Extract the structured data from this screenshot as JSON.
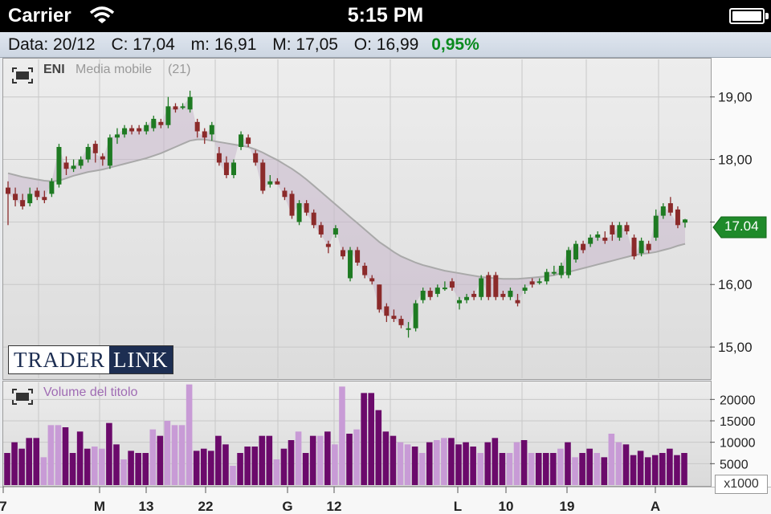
{
  "status": {
    "carrier": "Carrier",
    "time": "5:15 PM"
  },
  "quote": {
    "date": "Data: 20/12",
    "close": "C: 17,04",
    "min": "m: 16,91",
    "max": "M: 17,05",
    "open": "O: 16,99",
    "change": "0,95%"
  },
  "main_chart": {
    "symbol": "ENI",
    "indicator": "Media mobile",
    "indicator_period": "(21)",
    "current_price": "17.04"
  },
  "volume_chart": {
    "label": "Volume del titolo",
    "multiplier": "x1000"
  },
  "logo": {
    "part1": "TRADER",
    "part2": "LINK"
  },
  "colors": {
    "up": "#1e7a22",
    "down": "#8b2a2a",
    "ma_fill": "#c9b8cc",
    "vol_dark": "#6b0a6b",
    "vol_light": "#c89bd6",
    "accent_green": "#0a8a1e"
  },
  "chart_data": [
    {
      "type": "candlestick",
      "title": "ENI",
      "y_ticks": [
        "19,00",
        "18,00",
        "17,00",
        "16,00",
        "15,00"
      ],
      "ylim": [
        14.5,
        19.6
      ],
      "x_ticks": [
        "7",
        "M",
        "13",
        "22",
        "G",
        "12",
        "L",
        "10",
        "19",
        "A"
      ],
      "grid": true,
      "candles": [
        [
          17.55,
          17.45,
          17.65,
          16.95
        ],
        [
          17.45,
          17.35,
          17.55,
          17.25
        ],
        [
          17.35,
          17.25,
          17.45,
          17.2
        ],
        [
          17.3,
          17.45,
          17.55,
          17.25
        ],
        [
          17.5,
          17.4,
          17.55,
          17.35
        ],
        [
          17.4,
          17.35,
          17.5,
          17.3
        ],
        [
          17.45,
          17.65,
          17.7,
          17.4
        ],
        [
          17.6,
          18.2,
          18.25,
          17.55
        ],
        [
          17.95,
          17.85,
          18.05,
          17.75
        ],
        [
          17.85,
          17.9,
          18.0,
          17.8
        ],
        [
          17.9,
          18.0,
          18.05,
          17.85
        ],
        [
          18.0,
          18.2,
          18.25,
          17.95
        ],
        [
          18.25,
          18.1,
          18.3,
          17.95
        ],
        [
          18.05,
          18.0,
          18.1,
          17.9
        ],
        [
          17.9,
          18.35,
          18.4,
          17.85
        ],
        [
          18.35,
          18.4,
          18.5,
          18.25
        ],
        [
          18.4,
          18.5,
          18.55,
          18.35
        ],
        [
          18.5,
          18.45,
          18.55,
          18.4
        ],
        [
          18.5,
          18.45,
          18.55,
          18.4
        ],
        [
          18.45,
          18.55,
          18.6,
          18.4
        ],
        [
          18.5,
          18.65,
          18.7,
          18.45
        ],
        [
          18.6,
          18.55,
          18.65,
          18.5
        ],
        [
          18.55,
          18.85,
          19.0,
          18.5
        ],
        [
          18.85,
          18.8,
          18.9,
          18.75
        ],
        [
          18.85,
          18.85,
          18.9,
          18.8
        ],
        [
          18.8,
          19.0,
          19.1,
          18.75
        ],
        [
          18.6,
          18.45,
          18.65,
          18.35
        ],
        [
          18.45,
          18.35,
          18.5,
          18.25
        ],
        [
          18.4,
          18.55,
          18.6,
          18.3
        ],
        [
          18.1,
          17.95,
          18.2,
          17.9
        ],
        [
          17.95,
          17.75,
          18.05,
          17.7
        ],
        [
          17.75,
          17.95,
          18.0,
          17.7
        ],
        [
          18.2,
          18.4,
          18.45,
          18.15
        ],
        [
          18.35,
          18.25,
          18.4,
          18.2
        ],
        [
          18.1,
          17.95,
          18.15,
          17.9
        ],
        [
          17.95,
          17.5,
          18.0,
          17.45
        ],
        [
          17.6,
          17.65,
          17.75,
          17.55
        ],
        [
          17.65,
          17.6,
          17.7,
          17.6
        ],
        [
          17.5,
          17.4,
          17.55,
          17.35
        ],
        [
          17.45,
          17.1,
          17.5,
          17.05
        ],
        [
          17.0,
          17.3,
          17.35,
          16.95
        ],
        [
          17.3,
          17.15,
          17.35,
          17.1
        ],
        [
          17.15,
          16.95,
          17.2,
          16.9
        ],
        [
          16.95,
          16.8,
          17.0,
          16.75
        ],
        [
          16.65,
          16.6,
          16.7,
          16.5
        ],
        [
          16.8,
          16.9,
          16.95,
          16.75
        ],
        [
          16.55,
          16.45,
          16.6,
          16.4
        ],
        [
          16.1,
          16.55,
          16.6,
          16.05
        ],
        [
          16.55,
          16.35,
          16.6,
          16.3
        ],
        [
          16.3,
          16.15,
          16.35,
          16.1
        ],
        [
          16.1,
          16.05,
          16.15,
          16.0
        ],
        [
          16.0,
          15.6,
          16.0,
          15.55
        ],
        [
          15.65,
          15.5,
          15.7,
          15.4
        ],
        [
          15.5,
          15.45,
          15.6,
          15.4
        ],
        [
          15.45,
          15.35,
          15.5,
          15.3
        ],
        [
          15.3,
          15.3,
          15.4,
          15.15
        ],
        [
          15.3,
          15.7,
          15.75,
          15.25
        ],
        [
          15.75,
          15.9,
          15.95,
          15.7
        ],
        [
          15.9,
          15.8,
          15.95,
          15.75
        ],
        [
          15.85,
          15.95,
          16.0,
          15.8
        ],
        [
          15.95,
          15.95,
          16.05,
          15.9
        ],
        [
          16.05,
          15.95,
          16.1,
          15.9
        ],
        [
          15.7,
          15.75,
          15.8,
          15.6
        ],
        [
          15.75,
          15.8,
          15.85,
          15.7
        ],
        [
          15.85,
          15.8,
          15.9,
          15.75
        ],
        [
          15.8,
          16.1,
          16.15,
          15.75
        ],
        [
          16.15,
          15.8,
          16.2,
          15.75
        ],
        [
          16.15,
          15.8,
          16.2,
          15.75
        ],
        [
          15.85,
          15.8,
          15.9,
          15.75
        ],
        [
          15.8,
          15.9,
          15.95,
          15.75
        ],
        [
          15.75,
          15.7,
          15.85,
          15.65
        ],
        [
          15.9,
          15.95,
          16.0,
          15.85
        ],
        [
          16.05,
          16.0,
          16.1,
          15.95
        ],
        [
          16.05,
          16.05,
          16.1,
          16.0
        ],
        [
          16.05,
          16.2,
          16.25,
          16.0
        ],
        [
          16.2,
          16.2,
          16.3,
          16.15
        ],
        [
          16.15,
          16.3,
          16.35,
          16.1
        ],
        [
          16.15,
          16.55,
          16.6,
          16.1
        ],
        [
          16.4,
          16.65,
          16.7,
          16.35
        ],
        [
          16.65,
          16.55,
          16.7,
          16.5
        ],
        [
          16.65,
          16.75,
          16.8,
          16.6
        ],
        [
          16.75,
          16.8,
          16.85,
          16.7
        ],
        [
          16.75,
          16.7,
          16.85,
          16.65
        ],
        [
          16.95,
          16.8,
          17.0,
          16.7
        ],
        [
          16.75,
          16.95,
          17.0,
          16.7
        ],
        [
          16.95,
          16.85,
          17.0,
          16.8
        ],
        [
          16.75,
          16.45,
          16.8,
          16.4
        ],
        [
          16.5,
          16.7,
          16.75,
          16.45
        ],
        [
          16.65,
          16.55,
          16.7,
          16.5
        ],
        [
          16.75,
          17.1,
          17.2,
          16.7
        ],
        [
          17.1,
          17.25,
          17.3,
          17.05
        ],
        [
          17.3,
          17.15,
          17.4,
          17.1
        ],
        [
          17.2,
          16.95,
          17.25,
          16.9
        ],
        [
          16.99,
          17.04,
          17.05,
          16.91
        ]
      ],
      "moving_average": [
        17.78,
        17.75,
        17.72,
        17.7,
        17.68,
        17.66,
        17.65,
        17.66,
        17.7,
        17.74,
        17.77,
        17.8,
        17.82,
        17.84,
        17.87,
        17.9,
        17.93,
        17.96,
        17.99,
        18.02,
        18.06,
        18.1,
        18.15,
        18.2,
        18.25,
        18.3,
        18.32,
        18.32,
        18.3,
        18.28,
        18.26,
        18.24,
        18.22,
        18.2,
        18.16,
        18.11,
        18.05,
        17.99,
        17.92,
        17.85,
        17.77,
        17.68,
        17.58,
        17.48,
        17.38,
        17.28,
        17.18,
        17.08,
        16.98,
        16.88,
        16.78,
        16.68,
        16.6,
        16.52,
        16.45,
        16.4,
        16.35,
        16.31,
        16.28,
        16.25,
        16.22,
        16.2,
        16.18,
        16.16,
        16.14,
        16.12,
        16.11,
        16.1,
        16.09,
        16.09,
        16.09,
        16.1,
        16.11,
        16.12,
        16.13,
        16.15,
        16.18,
        16.2,
        16.23,
        16.26,
        16.29,
        16.32,
        16.35,
        16.38,
        16.41,
        16.44,
        16.47,
        16.49,
        16.5,
        16.52,
        16.55,
        16.58,
        16.62,
        16.65
      ]
    },
    {
      "type": "bar",
      "title": "Volume del titolo",
      "y_ticks": [
        "20000",
        "15000",
        "10000",
        "5000"
      ],
      "ylim": [
        0,
        24000
      ],
      "unit": "x1000",
      "values": [
        7500,
        10000,
        8500,
        11000,
        11000,
        6500,
        14000,
        14000,
        13500,
        7500,
        12500,
        8500,
        9000,
        8500,
        14500,
        9500,
        6000,
        8000,
        7500,
        7500,
        13000,
        11500,
        15000,
        14000,
        14000,
        23500,
        8000,
        8500,
        8000,
        11500,
        9500,
        4500,
        7500,
        9000,
        9000,
        11500,
        11500,
        6000,
        8500,
        10500,
        12500,
        7500,
        11500,
        11500,
        12500,
        9500,
        23000,
        12000,
        13000,
        21500,
        21500,
        17500,
        12500,
        11500,
        10000,
        9500,
        9000,
        7500,
        10000,
        10500,
        11000,
        11000,
        9500,
        10000,
        9000,
        7500,
        10000,
        11000,
        7500,
        7500,
        10000,
        10500,
        7500,
        7500,
        7500,
        7500,
        8500,
        10000,
        6500,
        7500,
        8500,
        7500,
        6500,
        12000,
        10000,
        9500,
        7000,
        8000,
        6500,
        7000,
        7500,
        8500,
        7000,
        7500
      ],
      "colors_index": [
        0,
        0,
        0,
        0,
        0,
        1,
        1,
        1,
        0,
        0,
        0,
        0,
        1,
        1,
        0,
        0,
        1,
        0,
        0,
        0,
        1,
        0,
        1,
        1,
        1,
        1,
        0,
        0,
        0,
        0,
        0,
        1,
        0,
        0,
        0,
        0,
        0,
        1,
        0,
        0,
        1,
        0,
        0,
        1,
        0,
        1,
        1,
        0,
        1,
        0,
        0,
        0,
        0,
        0,
        1,
        1,
        0,
        1,
        0,
        1,
        1,
        0,
        0,
        0,
        0,
        1,
        0,
        0,
        0,
        1,
        1,
        0,
        1,
        0,
        0,
        0,
        1,
        0,
        1,
        0,
        0,
        1,
        0,
        1,
        1,
        0,
        0,
        0,
        0,
        0,
        0,
        0,
        0,
        0
      ]
    }
  ]
}
